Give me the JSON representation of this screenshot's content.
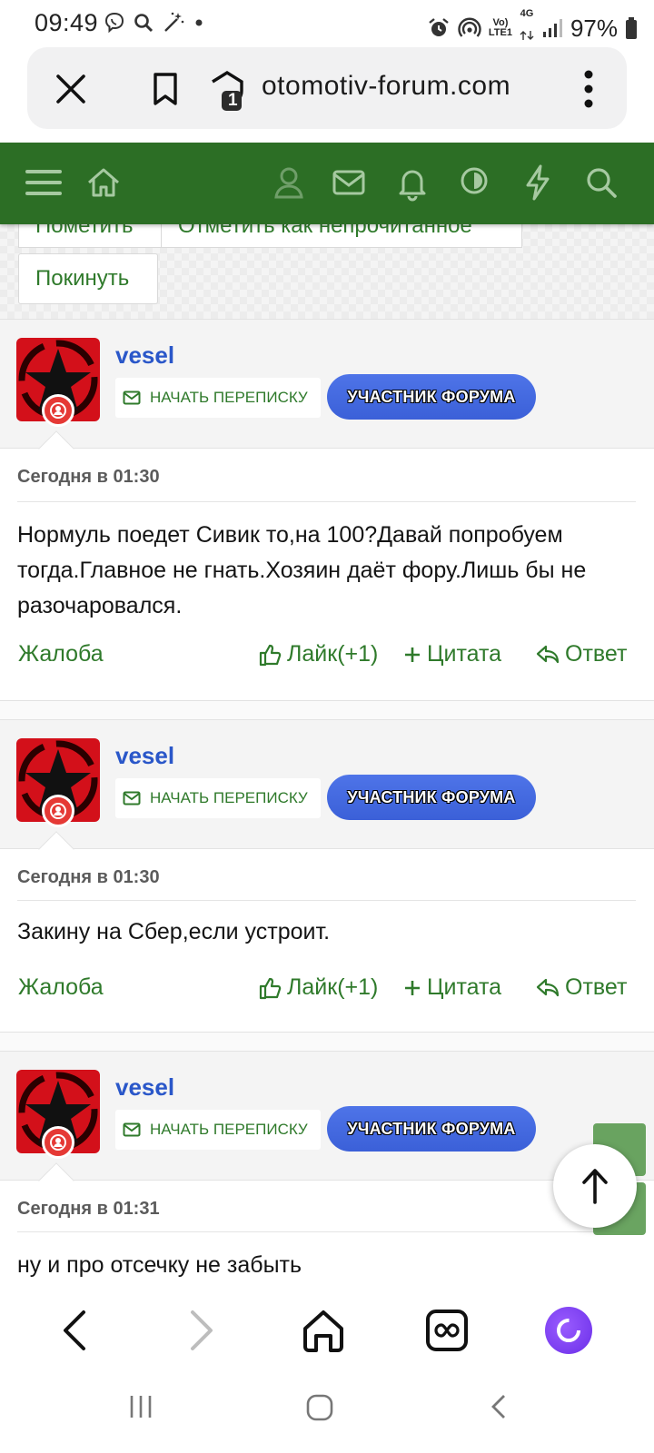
{
  "status_bar": {
    "time": "09:49",
    "battery": "97%",
    "network": "4G",
    "volte_top": "Vo)",
    "volte_bottom": "LTE1"
  },
  "browser": {
    "url": "otomotiv-forum.com",
    "tab_count": "1"
  },
  "thread_buttons": {
    "mark": "Пометить",
    "mark_unread": "Отметить как непрочитанное",
    "leave": "Покинуть"
  },
  "posts": [
    {
      "username": "vesel",
      "pm_label": "НАЧАТЬ ПЕРЕПИСКУ",
      "role": "УЧАСТНИК ФОРУМА",
      "date": "Сегодня в 01:30",
      "body": "Нормуль поедет Сивик то,на 100?Давай попробуем тогда.Главное не гнать.Хозяин даёт фору.Лишь бы не разочаровался.",
      "report": "Жалоба",
      "like": "Лайк(+1)",
      "quote": "Цитата",
      "reply": "Ответ"
    },
    {
      "username": "vesel",
      "pm_label": "НАЧАТЬ ПЕРЕПИСКУ",
      "role": "УЧАСТНИК ФОРУМА",
      "date": "Сегодня в 01:30",
      "body": "Закину на Сбер,если устроит.",
      "report": "Жалоба",
      "like": "Лайк(+1)",
      "quote": "Цитата",
      "reply": "Ответ"
    },
    {
      "username": "vesel",
      "pm_label": "НАЧАТЬ ПЕРЕПИСКУ",
      "role": "УЧАСТНИК ФОРУМА",
      "date": "Сегодня в 01:31",
      "body": "ну и про отсечку не забыть"
    }
  ],
  "colors": {
    "forum_green": "#2c6e25",
    "link_green": "#2f7a2b",
    "username_blue": "#2a57c9",
    "badge_blue": "#3b60d8",
    "alice_purple": "#7b3ff2"
  }
}
